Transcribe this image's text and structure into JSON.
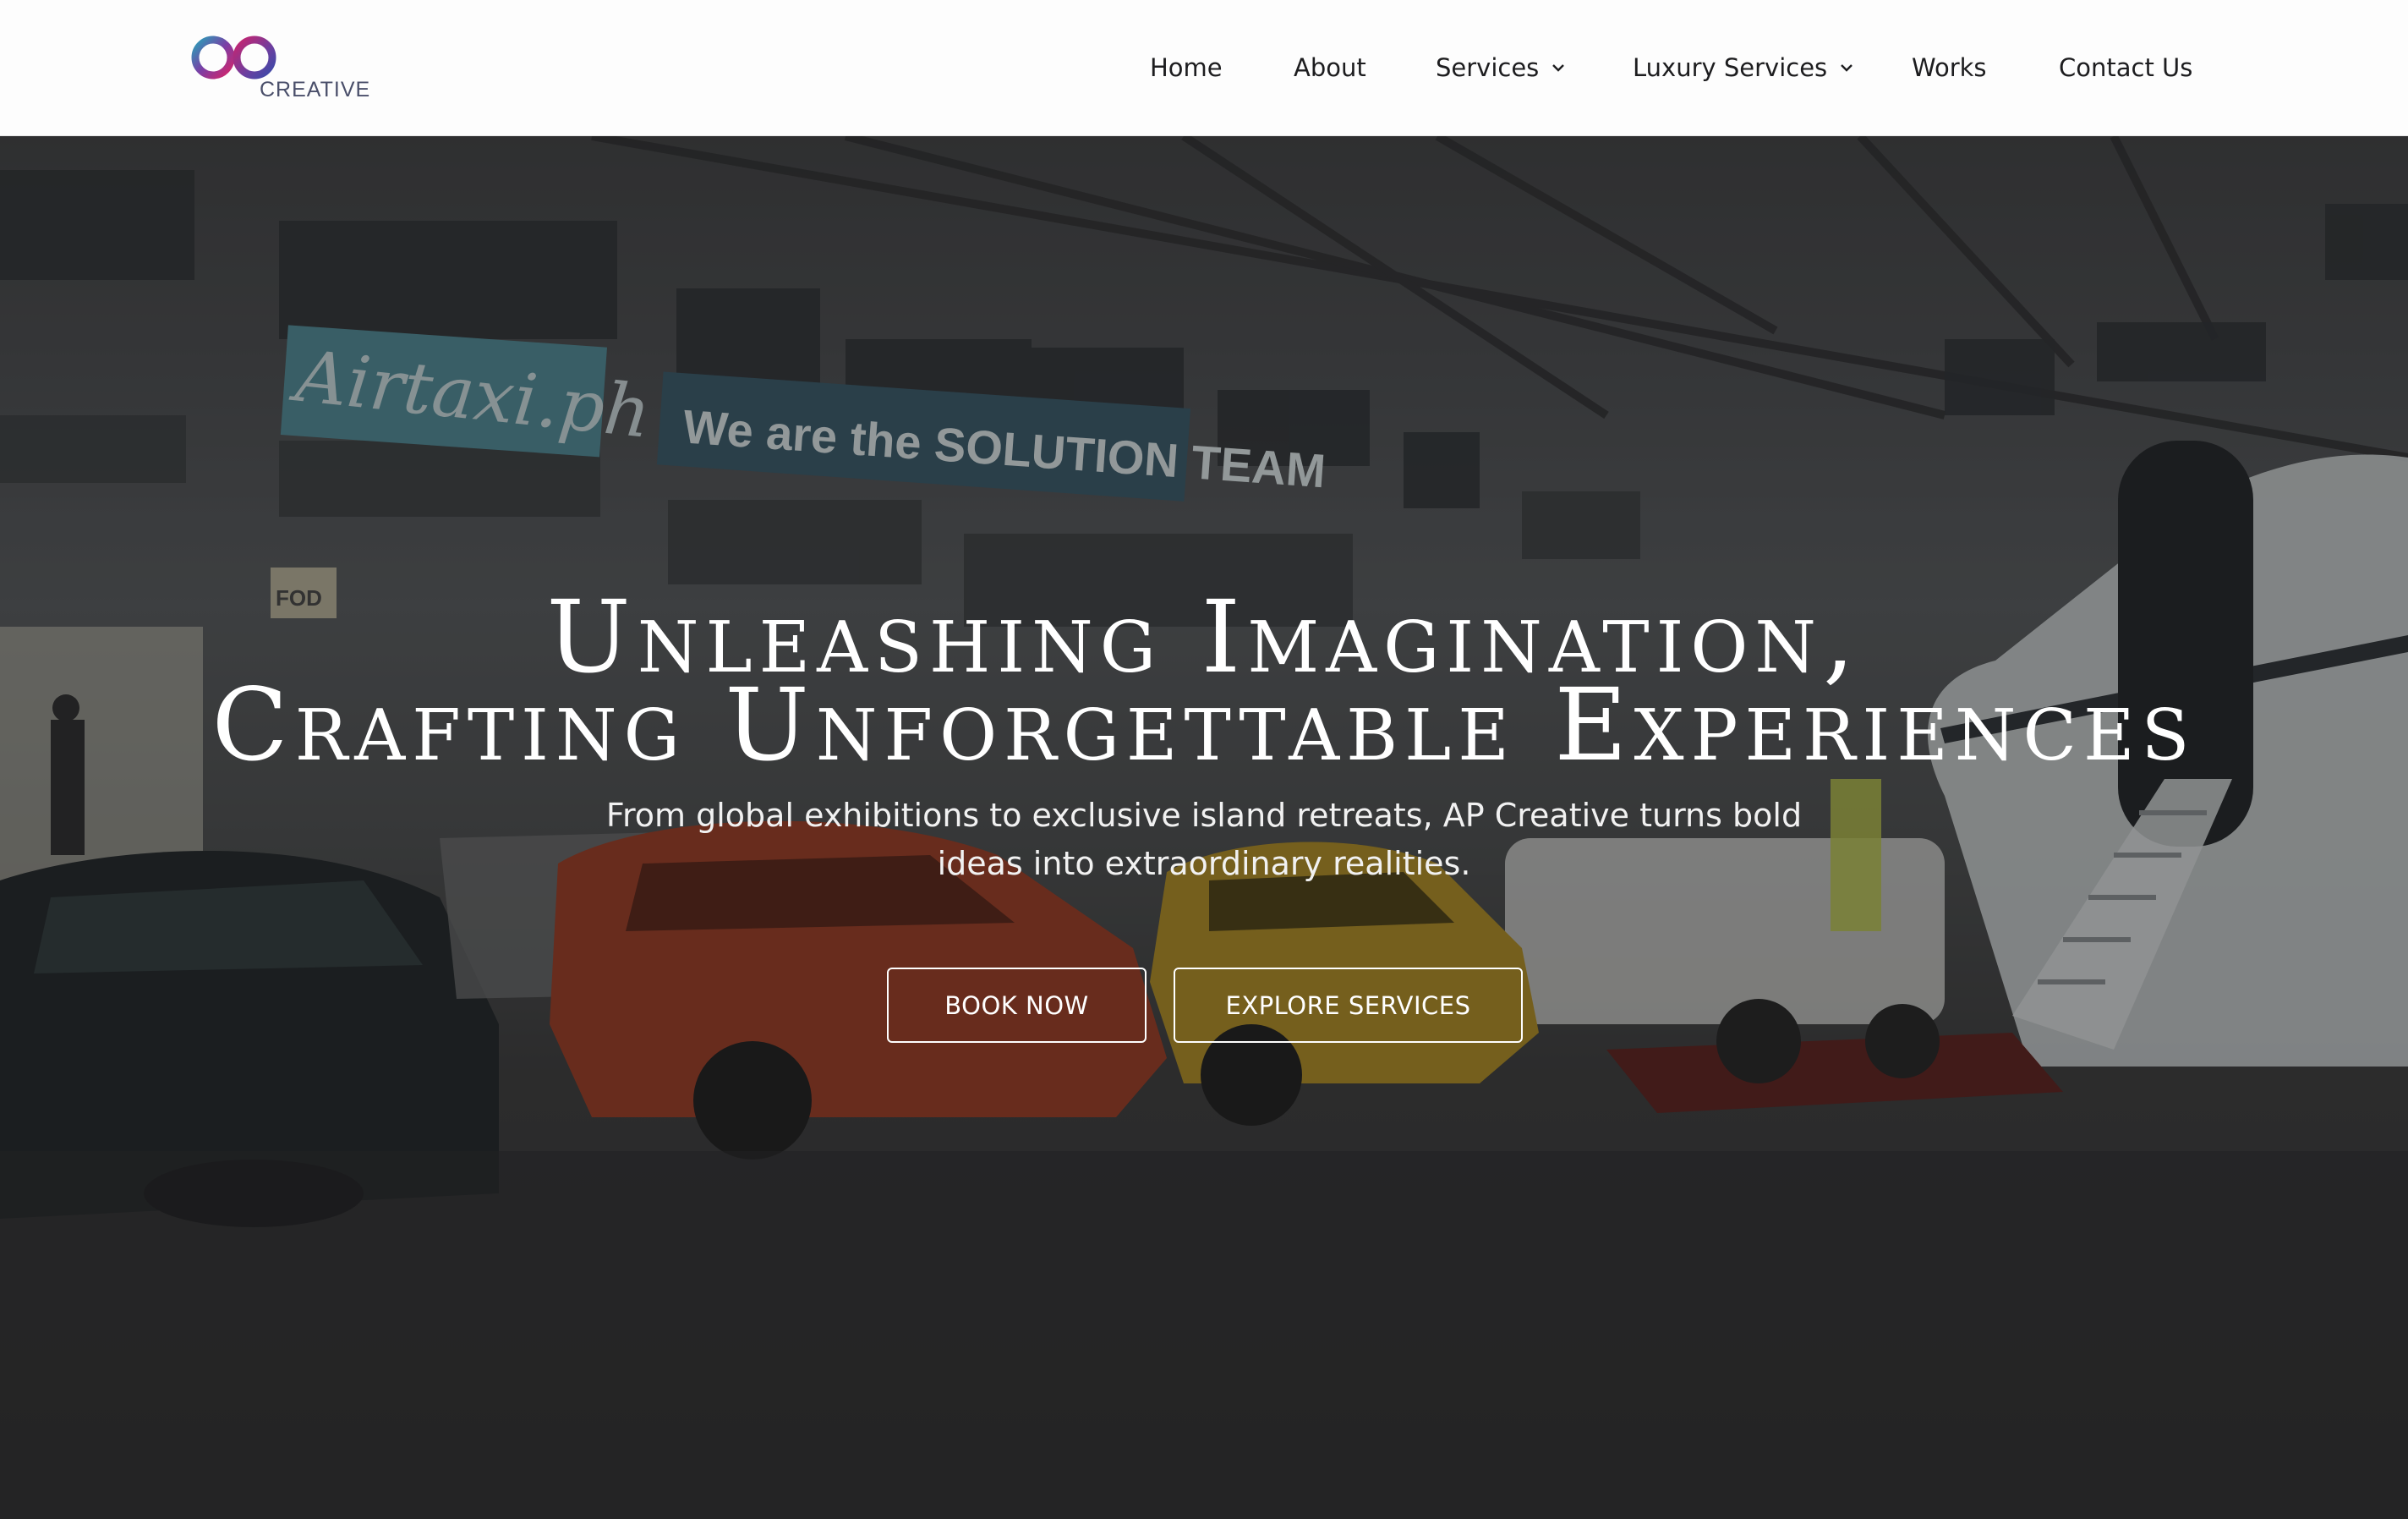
{
  "brand": {
    "logo_letters": "ap",
    "logo_text": "CREATIVE",
    "colors": {
      "purple": "#6b3fa0",
      "magenta": "#d3246a",
      "teal": "#2a9fb8"
    }
  },
  "nav": {
    "items": [
      {
        "label": "Home",
        "has_dropdown": false
      },
      {
        "label": "About",
        "has_dropdown": false
      },
      {
        "label": "Services",
        "has_dropdown": true
      },
      {
        "label": "Luxury Services",
        "has_dropdown": true
      },
      {
        "label": "Works",
        "has_dropdown": false
      },
      {
        "label": "Contact Us",
        "has_dropdown": false
      }
    ]
  },
  "hero": {
    "title_line1": "Unleashing Imagination,",
    "title_line2": "Crafting Unforgettable Experiences",
    "subtitle": "From global exhibitions to exclusive island retreats, AP Creative turns bold ideas into extraordinary realities.",
    "background_texts": {
      "sign_script": "Airtaxi.ph",
      "banner": "We are the SOLUTION TEAM",
      "small_sign": "FOD"
    },
    "buttons": {
      "book_now": "BOOK NOW",
      "explore_services": "EXPLORE SERVICES"
    }
  }
}
